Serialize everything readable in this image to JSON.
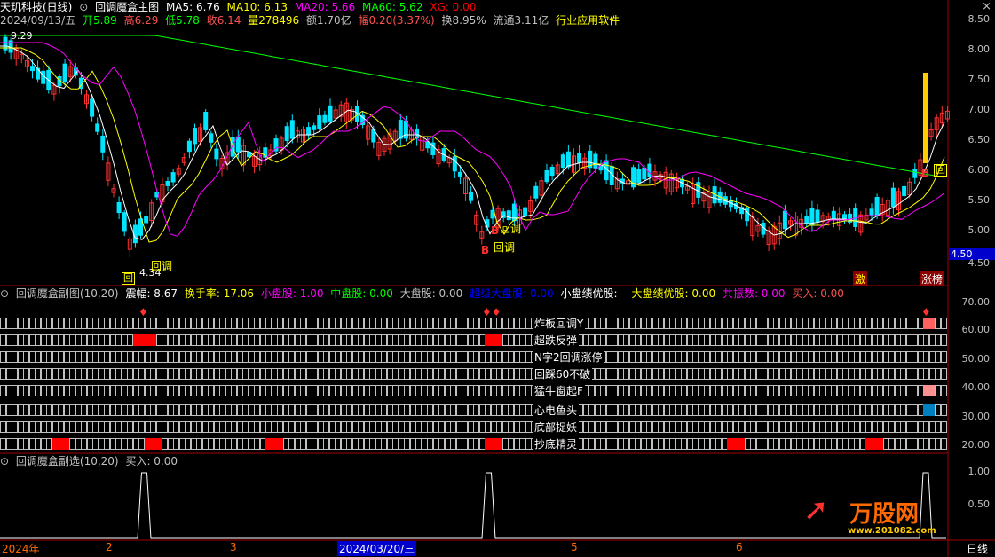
{
  "main": {
    "stock": "天玑科技(日线)",
    "indicator": "回调魔盒主图",
    "ma": [
      {
        "label": "MA5: 6.76",
        "color": "#ffffff"
      },
      {
        "label": "MA10: 6.13",
        "color": "#ffff00"
      },
      {
        "label": "MA20: 5.66",
        "color": "#ff00ff"
      },
      {
        "label": "MA60: 5.62",
        "color": "#00ff00"
      },
      {
        "label": "XG: 0.00",
        "color": "#ff0000"
      }
    ],
    "quote": [
      {
        "label": "2024/09/13/五",
        "color": "#c0c0c0"
      },
      {
        "label": "开5.89",
        "color": "#00ff00"
      },
      {
        "label": "高6.29",
        "color": "#ff5050"
      },
      {
        "label": "低5.78",
        "color": "#00ff00"
      },
      {
        "label": "收6.14",
        "color": "#ff5050"
      },
      {
        "label": "量278496",
        "color": "#ffff00"
      },
      {
        "label": "额1.70亿",
        "color": "#c0c0c0"
      },
      {
        "label": "幅0.20(3.37%)",
        "color": "#ff5050"
      },
      {
        "label": "换8.95%",
        "color": "#c0c0c0"
      },
      {
        "label": "流通3.11亿",
        "color": "#c0c0c0"
      },
      {
        "label": "行业应用软件",
        "color": "#ffff00"
      }
    ],
    "high_label": "9.29",
    "low_label": "4.34",
    "current_price": "4.50",
    "tag_huitiao": "回调",
    "tag_b": "B",
    "tag_hui": "回",
    "tag_ji": "激",
    "tag_zhangting": "涨榜",
    "y_axis": [
      "8.50",
      "8.00",
      "7.50",
      "7.00",
      "6.50",
      "6.00",
      "5.50",
      "5.00",
      "4.50"
    ]
  },
  "sub1": {
    "title": "回调魔盒副图(10,20)",
    "stats": [
      {
        "label": "震幅: 8.67",
        "color": "#ffffff"
      },
      {
        "label": "换手率: 17.06",
        "color": "#ffff00"
      },
      {
        "label": "小盘股: 1.00",
        "color": "#ff00ff"
      },
      {
        "label": "中盘股: 0.00",
        "color": "#00ff00"
      },
      {
        "label": "大盘股: 0.00",
        "color": "#c0c0c0"
      },
      {
        "label": "超级大盘股: 0.00",
        "color": "#0000ff"
      },
      {
        "label": "小盘绩优股: -",
        "color": "#ffffff"
      },
      {
        "label": "大盘绩优股: 0.00",
        "color": "#ffff00"
      },
      {
        "label": "共振数: 0.00",
        "color": "#ff00ff"
      },
      {
        "label": "买入: 0.00",
        "color": "#ff5050"
      }
    ],
    "rows": [
      "炸板回调Y",
      "超跌反弹",
      "N字2回调涨停",
      "回踩60不破",
      "猛牛窗起F",
      "心电鱼头",
      "底部捉妖",
      "抄底精灵"
    ],
    "y_axis": [
      "70.00",
      "60.00",
      "50.00",
      "40.00",
      "30.00",
      "20.00"
    ]
  },
  "sub2": {
    "title": "回调魔盒副选(10,20)",
    "buy": "买入: 0.00",
    "y_axis": [
      "1.00",
      "0.50"
    ]
  },
  "xaxis": {
    "labels": [
      "2024年",
      "2",
      "3",
      "2024/03/20/三",
      "5",
      "6"
    ],
    "right_label": "日线"
  },
  "watermark": {
    "brand": "万股网",
    "url": "www.201082.com"
  }
}
